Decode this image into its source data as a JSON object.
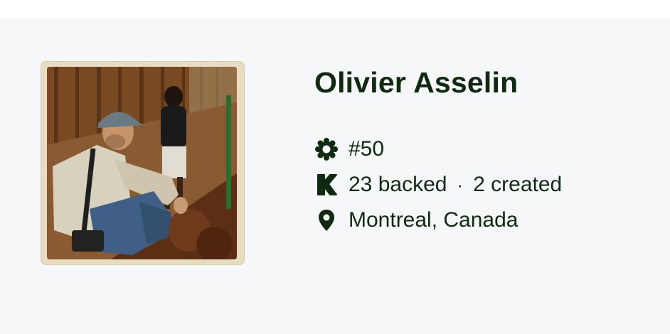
{
  "profile": {
    "name": "Olivier Asselin",
    "rank": "#50",
    "backed": "23 backed",
    "separator": "·",
    "created": "2 created",
    "location": "Montreal, Canada"
  },
  "icons": {
    "rank": "badge-icon",
    "backed": "kickstarter-k-icon",
    "location": "map-pin-icon"
  },
  "colors": {
    "text": "#0f2a10",
    "background": "#f6f7f8",
    "frame": "#e8dcc2"
  }
}
